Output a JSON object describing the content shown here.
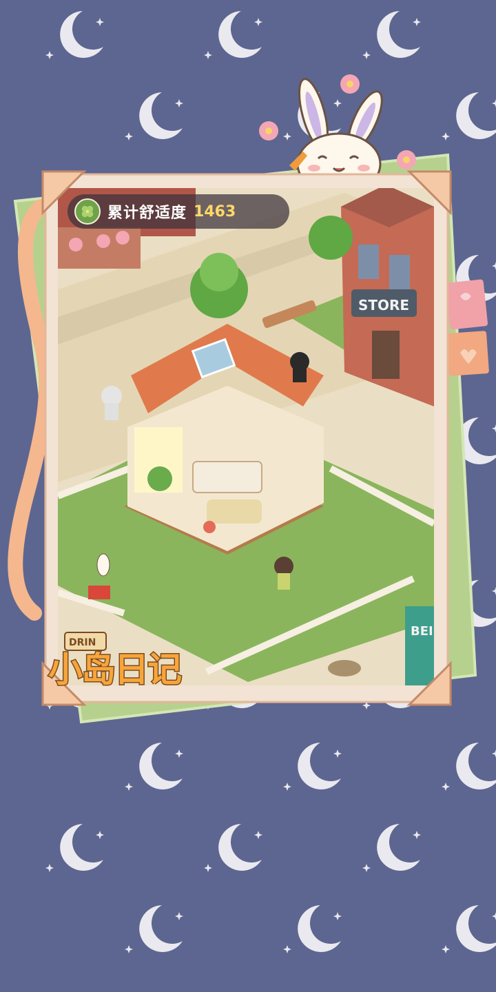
{
  "hud": {
    "comfort_label": "累计舒适度",
    "comfort_value": "1463",
    "icon": "clover-icon"
  },
  "scene": {
    "store_sign": "STORE",
    "drink_sign": "DRIN",
    "bench_sign": "BEI"
  },
  "logo": {
    "title": "小岛日记"
  },
  "colors": {
    "background": "#5d6690",
    "moon": "#e9e9ef",
    "card_frame": "#f5e9dc",
    "grass": "#8ab55c",
    "accent_orange": "#e07a4c",
    "value_yellow": "#ffd86a"
  }
}
